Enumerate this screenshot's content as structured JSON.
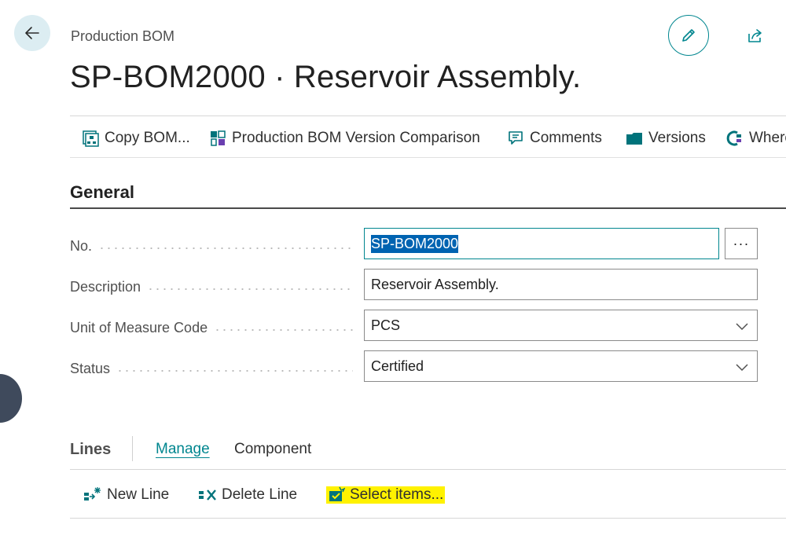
{
  "header": {
    "breadcrumb": "Production BOM",
    "title": "SP-BOM2000 · Reservoir Assembly."
  },
  "actions": [
    {
      "label": "Copy BOM...",
      "icon": "copy-bom-icon"
    },
    {
      "label": "Production BOM Version Comparison",
      "icon": "version-comparison-icon"
    },
    {
      "label": "Comments",
      "icon": "comments-icon"
    },
    {
      "label": "Versions",
      "icon": "folder-icon"
    },
    {
      "label": "Where",
      "icon": "where-used-icon"
    }
  ],
  "general": {
    "title": "General",
    "fields": {
      "no": {
        "label": "No.",
        "value": "SP-BOM2000"
      },
      "description": {
        "label": "Description",
        "value": "Reservoir Assembly."
      },
      "uom": {
        "label": "Unit of Measure Code",
        "value": "PCS"
      },
      "status": {
        "label": "Status",
        "value": "Certified"
      }
    },
    "assist_label": "···"
  },
  "lines": {
    "title": "Lines",
    "tabs": [
      "Manage",
      "Component"
    ],
    "actions": [
      {
        "label": "New Line",
        "icon": "new-line-icon"
      },
      {
        "label": "Delete Line",
        "icon": "delete-line-icon"
      },
      {
        "label": "Select items...",
        "icon": "select-items-icon",
        "highlighted": true
      }
    ]
  },
  "colors": {
    "accent": "#00868f",
    "selection": "#0063b1",
    "highlight": "#fff200",
    "back_button_bg": "#dcedf2"
  }
}
